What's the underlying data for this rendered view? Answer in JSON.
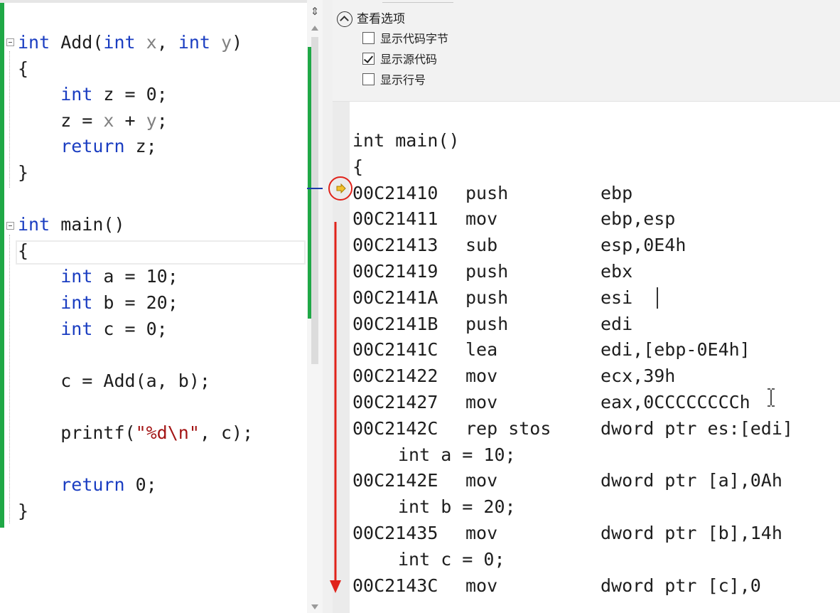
{
  "source_editor": {
    "lines": [
      {
        "tokens": [
          {
            "t": "int",
            "c": "kw"
          },
          {
            "t": " Add(",
            "c": ""
          },
          {
            "t": "int",
            "c": "kw"
          },
          {
            "t": " ",
            "c": ""
          },
          {
            "t": "x",
            "c": "param"
          },
          {
            "t": ", ",
            "c": ""
          },
          {
            "t": "int",
            "c": "kw"
          },
          {
            "t": " ",
            "c": ""
          },
          {
            "t": "y",
            "c": "param"
          },
          {
            "t": ")",
            "c": ""
          }
        ]
      },
      {
        "tokens": [
          {
            "t": "{",
            "c": ""
          }
        ]
      },
      {
        "tokens": [
          {
            "t": "    ",
            "c": ""
          },
          {
            "t": "int",
            "c": "kw"
          },
          {
            "t": " z = 0;",
            "c": ""
          }
        ]
      },
      {
        "tokens": [
          {
            "t": "    z = ",
            "c": ""
          },
          {
            "t": "x",
            "c": "param"
          },
          {
            "t": " + ",
            "c": ""
          },
          {
            "t": "y",
            "c": "param"
          },
          {
            "t": ";",
            "c": ""
          }
        ]
      },
      {
        "tokens": [
          {
            "t": "    ",
            "c": ""
          },
          {
            "t": "return",
            "c": "kw"
          },
          {
            "t": " z;",
            "c": ""
          }
        ]
      },
      {
        "tokens": [
          {
            "t": "}",
            "c": ""
          }
        ]
      },
      {
        "tokens": []
      },
      {
        "tokens": [
          {
            "t": "int",
            "c": "kw"
          },
          {
            "t": " main()",
            "c": ""
          }
        ]
      },
      {
        "tokens": [
          {
            "t": "{",
            "c": ""
          }
        ]
      },
      {
        "tokens": [
          {
            "t": "    ",
            "c": ""
          },
          {
            "t": "int",
            "c": "kw"
          },
          {
            "t": " a = 10;",
            "c": ""
          }
        ]
      },
      {
        "tokens": [
          {
            "t": "    ",
            "c": ""
          },
          {
            "t": "int",
            "c": "kw"
          },
          {
            "t": " b = 20;",
            "c": ""
          }
        ]
      },
      {
        "tokens": [
          {
            "t": "    ",
            "c": ""
          },
          {
            "t": "int",
            "c": "kw"
          },
          {
            "t": " c = 0;",
            "c": ""
          }
        ]
      },
      {
        "tokens": []
      },
      {
        "tokens": [
          {
            "t": "    c = Add(a, b);",
            "c": ""
          }
        ]
      },
      {
        "tokens": []
      },
      {
        "tokens": [
          {
            "t": "    printf(",
            "c": ""
          },
          {
            "t": "\"%d\\n\"",
            "c": "str"
          },
          {
            "t": ", c);",
            "c": ""
          }
        ]
      },
      {
        "tokens": []
      },
      {
        "tokens": [
          {
            "t": "    ",
            "c": ""
          },
          {
            "t": "return",
            "c": "kw"
          },
          {
            "t": " 0;",
            "c": ""
          }
        ]
      },
      {
        "tokens": [
          {
            "t": "}",
            "c": ""
          }
        ]
      }
    ]
  },
  "scrollbar": {
    "split_glyph": "⇕"
  },
  "options": {
    "title": "查看选项",
    "items": [
      {
        "label": "显示代码字节",
        "checked": false
      },
      {
        "label": "显示源代码",
        "checked": true
      },
      {
        "label": "显示行号",
        "checked": false
      }
    ]
  },
  "disassembly": {
    "lines": [
      {
        "kind": "src",
        "text": "int main()"
      },
      {
        "kind": "src",
        "text": "{"
      },
      {
        "kind": "asm",
        "addr": "00C21410",
        "mnemonic": "push",
        "operands": "ebp",
        "current": true
      },
      {
        "kind": "asm",
        "addr": "00C21411",
        "mnemonic": "mov",
        "operands": "ebp,esp"
      },
      {
        "kind": "asm",
        "addr": "00C21413",
        "mnemonic": "sub",
        "operands": "esp,0E4h"
      },
      {
        "kind": "asm",
        "addr": "00C21419",
        "mnemonic": "push",
        "operands": "ebx"
      },
      {
        "kind": "asm",
        "addr": "00C2141A",
        "mnemonic": "push",
        "operands": "esi"
      },
      {
        "kind": "asm",
        "addr": "00C2141B",
        "mnemonic": "push",
        "operands": "edi"
      },
      {
        "kind": "asm",
        "addr": "00C2141C",
        "mnemonic": "lea",
        "operands": "edi,[ebp-0E4h]"
      },
      {
        "kind": "asm",
        "addr": "00C21422",
        "mnemonic": "mov",
        "operands": "ecx,39h"
      },
      {
        "kind": "asm",
        "addr": "00C21427",
        "mnemonic": "mov",
        "operands": "eax,0CCCCCCCCh"
      },
      {
        "kind": "asm",
        "addr": "00C2142C",
        "mnemonic": "rep stos",
        "operands": "dword ptr es:[edi]"
      },
      {
        "kind": "src_indent",
        "text": "int a = 10;"
      },
      {
        "kind": "asm",
        "addr": "00C2142E",
        "mnemonic": "mov",
        "operands": "dword ptr [a],0Ah"
      },
      {
        "kind": "src_indent",
        "text": "int b = 20;"
      },
      {
        "kind": "asm",
        "addr": "00C21435",
        "mnemonic": "mov",
        "operands": "dword ptr [b],14h"
      },
      {
        "kind": "src_indent",
        "text": "int c = 0;"
      },
      {
        "kind": "asm",
        "addr": "00C2143C",
        "mnemonic": "mov",
        "operands": "dword ptr [c],0"
      }
    ]
  },
  "colors": {
    "keyword": "#1a3dc1",
    "param": "#808080",
    "string": "#a31515",
    "change_bar": "#1fa846",
    "annotation_red": "#e0231b",
    "ip_arrow": "#f2c12e"
  }
}
